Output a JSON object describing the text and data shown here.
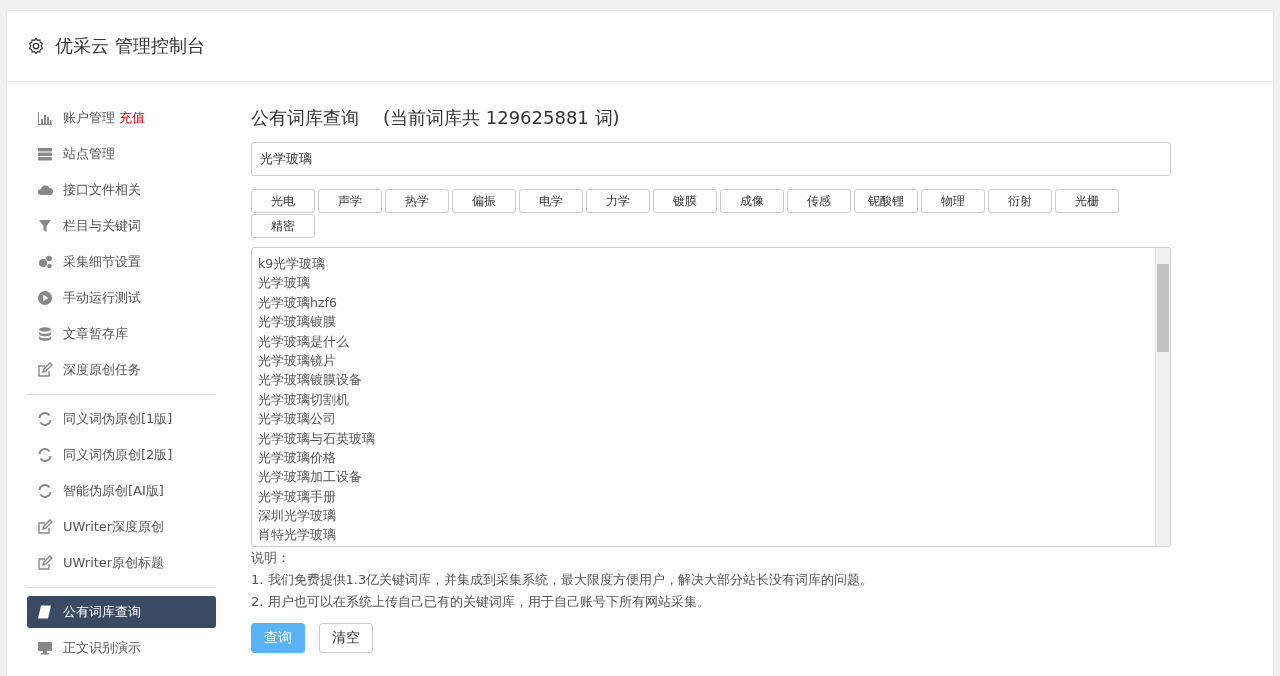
{
  "header": {
    "title": "优采云 管理控制台"
  },
  "sidebar": {
    "groups": [
      {
        "items": [
          {
            "label": "账户管理",
            "badge": "充值",
            "selected": false
          },
          {
            "label": "站点管理",
            "selected": false
          },
          {
            "label": "接口文件相关",
            "selected": false
          },
          {
            "label": "栏目与关键词",
            "selected": false
          },
          {
            "label": "采集细节设置",
            "selected": false
          },
          {
            "label": "手动运行测试",
            "selected": false
          },
          {
            "label": "文章暂存库",
            "selected": false
          },
          {
            "label": "深度原创任务",
            "selected": false
          }
        ]
      },
      {
        "items": [
          {
            "label": "同义词伪原创[1版]",
            "selected": false
          },
          {
            "label": "同义词伪原创[2版]",
            "selected": false
          },
          {
            "label": "智能伪原创[AI版]",
            "selected": false
          },
          {
            "label": "UWriter深度原创",
            "selected": false
          },
          {
            "label": "UWriter原创标题",
            "selected": false
          }
        ]
      },
      {
        "items": [
          {
            "label": "公有词库查询",
            "selected": true
          },
          {
            "label": "正文识别演示",
            "selected": false
          }
        ]
      }
    ]
  },
  "main": {
    "title": "公有词库查询",
    "count_note": "(当前词库共 129625881 词)",
    "search": {
      "value": "光学玻璃"
    },
    "tags": [
      "光电",
      "声学",
      "热学",
      "偏振",
      "电学",
      "力学",
      "镀膜",
      "成像",
      "传感",
      "铌酸锂",
      "物理",
      "衍射",
      "光栅",
      "精密"
    ],
    "results": [
      "k9光学玻璃",
      "光学玻璃",
      "光学玻璃hzf6",
      "光学玻璃镀膜",
      "光学玻璃是什么",
      "光学玻璃镜片",
      "光学玻璃镀膜设备",
      "光学玻璃切割机",
      "光学玻璃公司",
      "光学玻璃与石英玻璃",
      "光学玻璃价格",
      "光学玻璃加工设备",
      "光学玻璃手册",
      "深圳光学玻璃",
      "肖特光学玻璃"
    ],
    "notes_title": "说明：",
    "notes": [
      "1. 我们免费提供1.3亿关键词库，并集成到采集系统，最大限度方便用户，解决大部分站长没有词库的问题。",
      "2. 用户也可以在系统上传自己已有的关键词库，用于自己账号下所有网站采集。"
    ],
    "buttons": [
      {
        "label": "查询",
        "kind": "primary"
      },
      {
        "label": "清空",
        "kind": "default"
      }
    ]
  }
}
